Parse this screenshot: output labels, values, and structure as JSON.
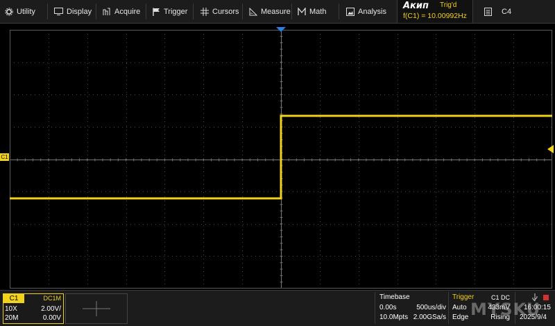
{
  "menu": [
    {
      "label": "Utility",
      "icon": "gear-icon"
    },
    {
      "label": "Display",
      "icon": "monitor-icon"
    },
    {
      "label": "Acquire",
      "icon": "acquire-icon"
    },
    {
      "label": "Trigger",
      "icon": "flag-icon"
    },
    {
      "label": "Cursors",
      "icon": "cursors-icon"
    },
    {
      "label": "Measure",
      "icon": "ruler-icon"
    },
    {
      "label": "Math",
      "icon": "math-icon"
    },
    {
      "label": "Analysis",
      "icon": "image-icon"
    }
  ],
  "brand": "Акип",
  "trigger_state": "Trig'd",
  "frequency": "f(C1) = 10.00992Hz",
  "channel_right": "C4",
  "channel_marker": "C1",
  "trace_color": "#f2d21b",
  "c1": {
    "tag": "C1",
    "coupling": "DC1M",
    "probe": "10X",
    "volts_div": "2.00V/",
    "bw": "20M",
    "offset": "0.00V"
  },
  "timebase": {
    "title": "Timebase",
    "delay": "0.00s",
    "scale": "500us/div",
    "points": "10.0Mpts",
    "rate": "2.00GSa/s"
  },
  "trigger": {
    "title": "Trigger",
    "source": "C1 DC",
    "mode": "Auto",
    "level": "433mV",
    "type": "Edge",
    "slope": "Rising"
  },
  "status": {
    "time": "16:00:15",
    "date": "2025/9/4"
  },
  "watermark": "MYSKU"
}
